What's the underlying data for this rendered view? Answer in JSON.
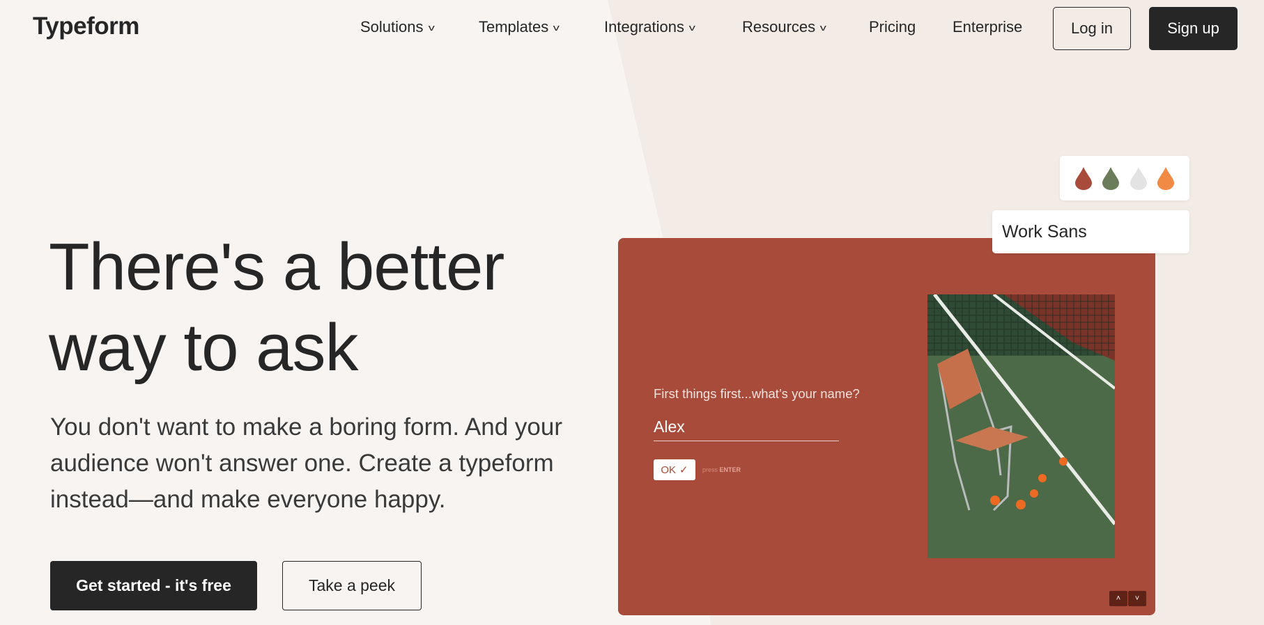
{
  "header": {
    "logo": "Typeform",
    "nav": [
      {
        "label": "Solutions",
        "dropdown": true
      },
      {
        "label": "Templates",
        "dropdown": true
      },
      {
        "label": "Integrations",
        "dropdown": true
      },
      {
        "label": "Resources",
        "dropdown": true
      },
      {
        "label": "Pricing",
        "dropdown": false
      },
      {
        "label": "Enterprise",
        "dropdown": false
      }
    ],
    "login": "Log in",
    "signup": "Sign up",
    "chevron": "⌄"
  },
  "hero": {
    "title_line1": "There's a better",
    "title_line2": "way to ask",
    "subtitle": "You don't want to make a boring form. And your audience won't answer one. Create a typeform instead—and make everyone happy.",
    "cta_primary": "Get started - it's free",
    "cta_secondary": "Take a peek"
  },
  "preview": {
    "palette_colors": [
      "#a84b3a",
      "#6b7c5a",
      "#e3e3e3",
      "#f08a45"
    ],
    "font_name": "Work Sans",
    "question": "First things first...what’s your name?",
    "answer": "Alex",
    "ok_label": "OK",
    "ok_icon": "✓",
    "press": "press",
    "enter": "ENTER",
    "up_icon": "˄",
    "down_icon": "˅",
    "card_color": "#a84b3a"
  }
}
